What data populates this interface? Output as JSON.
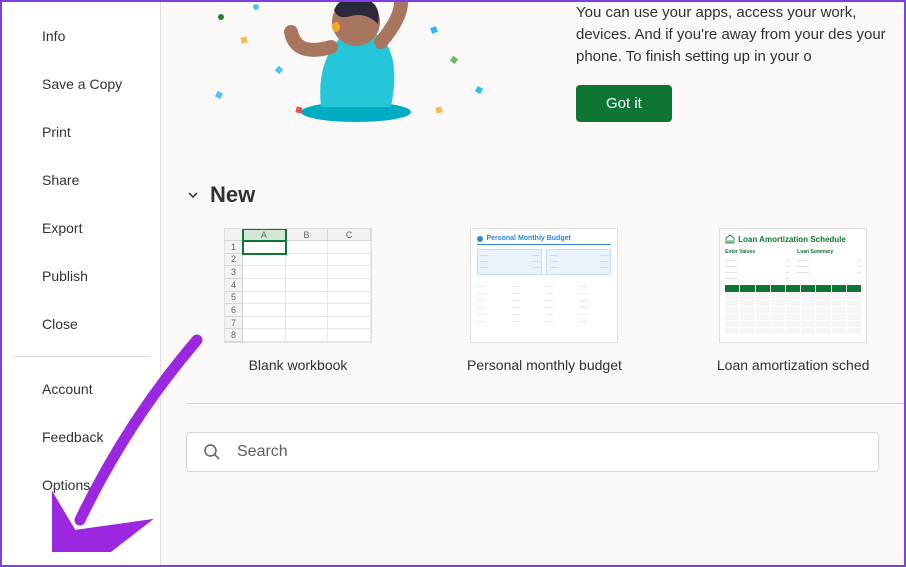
{
  "sidebar": {
    "items_top": [
      {
        "label": "Info",
        "name": "sidebar-item-info"
      },
      {
        "label": "Save a Copy",
        "name": "sidebar-item-save-a-copy"
      },
      {
        "label": "Print",
        "name": "sidebar-item-print"
      },
      {
        "label": "Share",
        "name": "sidebar-item-share"
      },
      {
        "label": "Export",
        "name": "sidebar-item-export"
      },
      {
        "label": "Publish",
        "name": "sidebar-item-publish"
      },
      {
        "label": "Close",
        "name": "sidebar-item-close"
      }
    ],
    "items_bottom": [
      {
        "label": "Account",
        "name": "sidebar-item-account"
      },
      {
        "label": "Feedback",
        "name": "sidebar-item-feedback"
      },
      {
        "label": "Options",
        "name": "sidebar-item-options"
      }
    ]
  },
  "banner": {
    "text": "You can use your apps, access your work, devices. And if you're away from your des your phone. To finish setting up in your o",
    "button_label": "Got it",
    "accent_color": "#0e7535"
  },
  "new_section": {
    "title": "New",
    "templates": [
      {
        "label": "Blank workbook",
        "name": "template-blank-workbook"
      },
      {
        "label": "Personal monthly budget",
        "name": "template-personal-monthly-budget",
        "thumb_title": "Personal Monthly Budget"
      },
      {
        "label": "Loan amortization sched",
        "name": "template-loan-amortization",
        "thumb_title": "Loan Amortization Schedule",
        "thumb_col1": "Enter Values",
        "thumb_col2": "Loan Summary"
      }
    ]
  },
  "spreadsheet_headers": {
    "cols": [
      "A",
      "B",
      "C"
    ],
    "rows": [
      "1",
      "2",
      "3",
      "4",
      "5",
      "6",
      "7",
      "8"
    ]
  },
  "search": {
    "placeholder": "Search"
  }
}
